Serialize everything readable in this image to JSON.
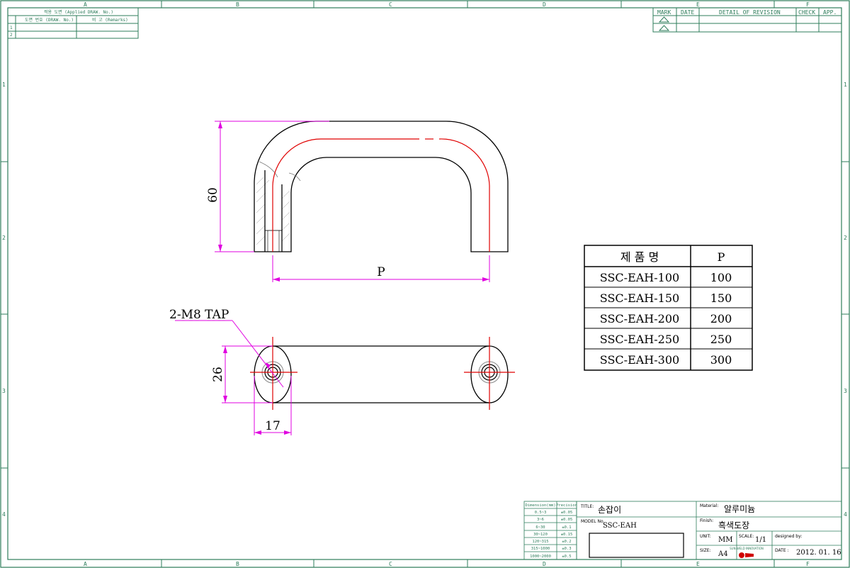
{
  "frame": {
    "columns": [
      "A",
      "B",
      "C",
      "D",
      "E",
      "F"
    ],
    "rows": [
      "1",
      "2",
      "3",
      "4"
    ]
  },
  "applied_table": {
    "header": "적용 도면 (Applied DRAW. No.)",
    "col1": "도면 번호 (DRAW. No.)",
    "col2": "비 고 (Remarks)",
    "rows": [
      "1",
      "2"
    ]
  },
  "revision_table": {
    "headers": [
      "MARK",
      "DATE",
      "DETAIL OF REVISION",
      "CHECK",
      "APP."
    ]
  },
  "dimensions": {
    "height": "60",
    "p": "P",
    "width": "26",
    "offset": "17",
    "tap": "2-M8 TAP"
  },
  "product_table": {
    "headers": [
      "제 품 명",
      "P"
    ],
    "rows": [
      {
        "name": "SSC-EAH-100",
        "p": "100"
      },
      {
        "name": "SSC-EAH-150",
        "p": "150"
      },
      {
        "name": "SSC-EAH-200",
        "p": "200"
      },
      {
        "name": "SSC-EAH-250",
        "p": "250"
      },
      {
        "name": "SSC-EAH-300",
        "p": "300"
      }
    ]
  },
  "tolerance_table": {
    "headers": [
      "Dimension(mm)",
      "Precision"
    ],
    "rows": [
      {
        "dim": "0.5~3",
        "prec": "±0.05"
      },
      {
        "dim": "3~6",
        "prec": "±0.05"
      },
      {
        "dim": "6~30",
        "prec": "±0.1"
      },
      {
        "dim": "30~120",
        "prec": "±0.15"
      },
      {
        "dim": "120~315",
        "prec": "±0.2"
      },
      {
        "dim": "315~1000",
        "prec": "±0.3"
      },
      {
        "dim": "1000~2000",
        "prec": "±0.5"
      }
    ]
  },
  "title_block": {
    "title_label": "TITLE:",
    "title": "손잡이",
    "model_label": "MODEL No.",
    "model": "SSC-EAH",
    "material_label": "Material:",
    "material": "알루미늄",
    "finish_label": "Finish:",
    "finish": "흑색도장",
    "unit_label": "UNIT:",
    "unit": "MM",
    "scale_label": "SCALE:",
    "scale": "1/1",
    "designed_label": "designed by:",
    "size_label": "SIZE:",
    "size": "A4",
    "date_label": "DATE :",
    "date": "2012. 01. 16",
    "logo_text": "SUN WELD INNOVATION"
  }
}
